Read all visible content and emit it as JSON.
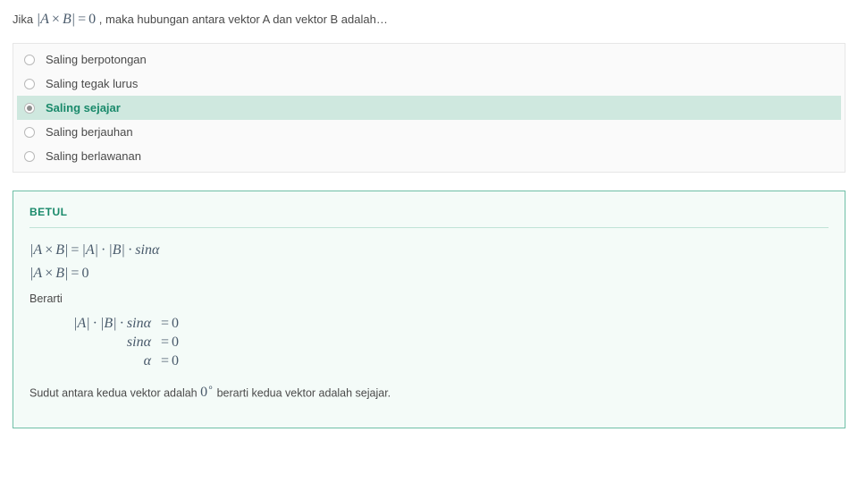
{
  "question": {
    "prefix": "Jika ",
    "math": "|A × B| = 0",
    "suffix": " , maka hubungan antara vektor A dan vektor B adalah…"
  },
  "options": [
    {
      "label": "Saling berpotongan",
      "selected": false
    },
    {
      "label": "Saling tegak lurus",
      "selected": false
    },
    {
      "label": "Saling sejajar",
      "selected": true
    },
    {
      "label": "Saling berjauhan",
      "selected": false
    },
    {
      "label": "Saling berlawanan",
      "selected": false
    }
  ],
  "feedback": {
    "title": "BETUL",
    "eq1": "|A × B| = |A| · |B| · sinα",
    "eq2": "|A × B| = 0",
    "text1": "Berarti",
    "align": [
      {
        "left": "|A| · |B| · sinα",
        "right": "= 0"
      },
      {
        "left": "sinα",
        "right": "= 0"
      },
      {
        "left": "α",
        "right": "= 0"
      }
    ],
    "conclusion_pre": "Sudut antara kedua vektor adalah ",
    "conclusion_math": "0°",
    "conclusion_post": " berarti kedua vektor adalah sejajar."
  }
}
